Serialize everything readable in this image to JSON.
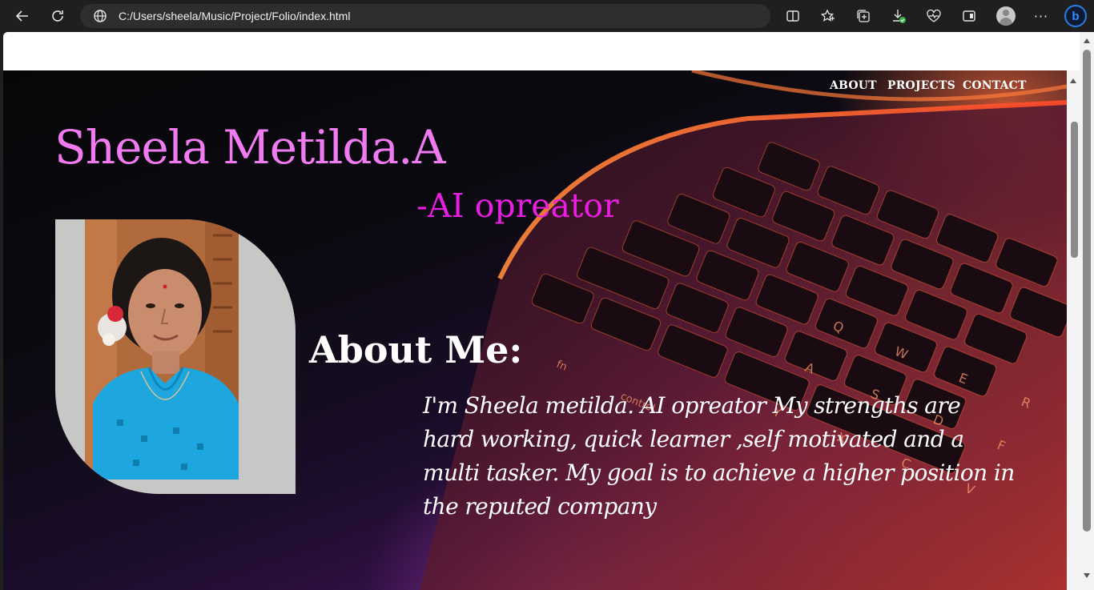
{
  "browser": {
    "url": "C:/Users/sheela/Music/Project/Folio/index.html",
    "icons": [
      "back-icon",
      "refresh-icon",
      "globe-icon",
      "split-screen-icon",
      "favorites-icon",
      "collections-icon",
      "downloads-icon",
      "performance-icon",
      "sidebar-icon",
      "profile-icon",
      "more-icon",
      "copilot-icon"
    ]
  },
  "nav": {
    "about": "ABOUT",
    "projects": "PROJECTS",
    "contact": "CONTACT"
  },
  "hero": {
    "name": "Sheela Metilda.A",
    "role": "-AI opreator"
  },
  "about": {
    "title": "About Me:",
    "text": "I'm Sheela metilda. AI opreator My strengths are hard working, quick learner ,self motivated and a multi tasker. My goal is to achieve a higher position in the reputed company"
  },
  "colors": {
    "name": "#f07bf0",
    "role": "#e81ee0",
    "text": "#ffffff"
  }
}
